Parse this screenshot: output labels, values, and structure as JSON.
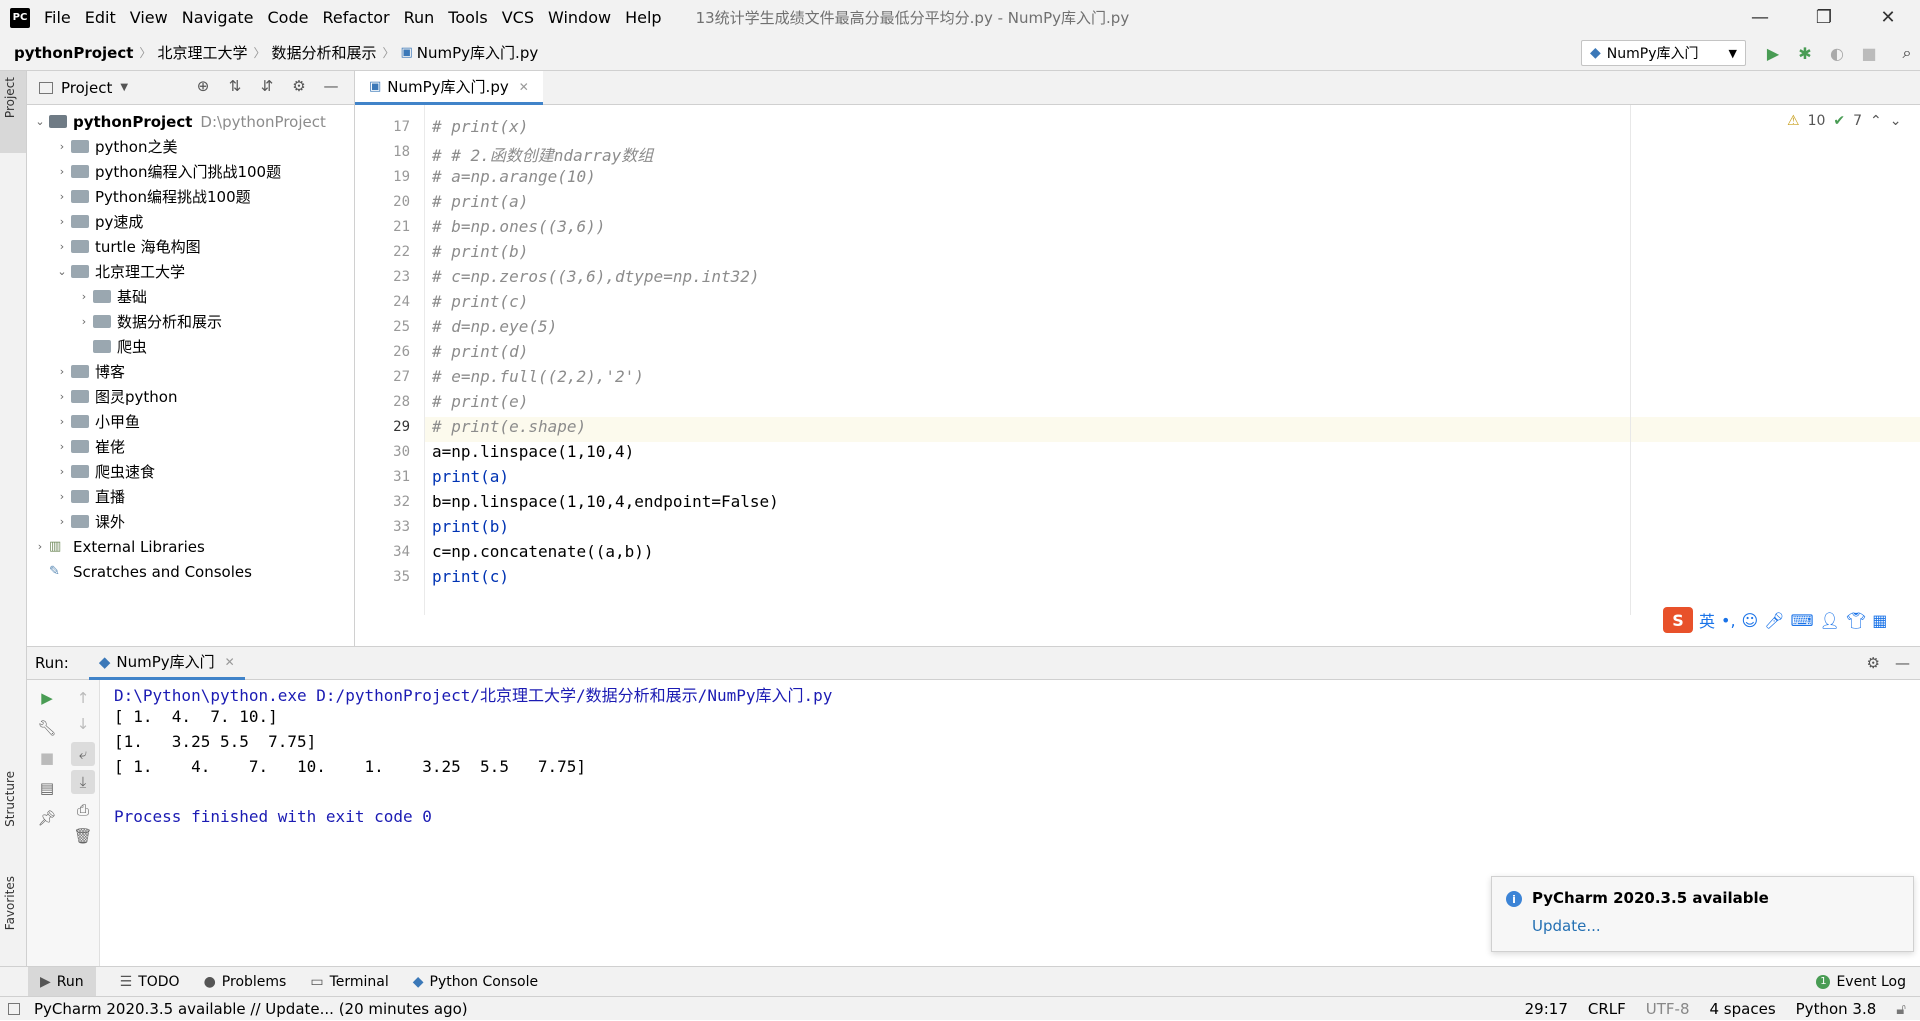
{
  "titlebar": {
    "menu": [
      "File",
      "Edit",
      "View",
      "Navigate",
      "Code",
      "Refactor",
      "Run",
      "Tools",
      "VCS",
      "Window",
      "Help"
    ],
    "window_title": "13统计学生成绩文件最高分最低分平均分.py - NumPy库入门.py"
  },
  "breadcrumb": [
    "pythonProject",
    "北京理工大学",
    "数据分析和展示",
    "NumPy库入门.py"
  ],
  "run_config": "NumPy库入门",
  "left_strip": {
    "project": "Project",
    "structure": "Structure",
    "favorites": "Favorites"
  },
  "project": {
    "title": "Project",
    "root_name": "pythonProject",
    "root_path": "D:\\pythonProject",
    "items": [
      {
        "label": "python之美"
      },
      {
        "label": "python编程入门挑战100题"
      },
      {
        "label": "Python编程挑战100题"
      },
      {
        "label": "py速成"
      },
      {
        "label": "turtle 海龟构图"
      },
      {
        "label": "北京理工大学"
      },
      {
        "label": "基础"
      },
      {
        "label": "数据分析和展示"
      },
      {
        "label": "爬虫"
      },
      {
        "label": "博客"
      },
      {
        "label": "图灵python"
      },
      {
        "label": "小甲鱼"
      },
      {
        "label": "崔佬"
      },
      {
        "label": "爬虫速食"
      },
      {
        "label": "直播"
      },
      {
        "label": "课外"
      }
    ],
    "external": "External Libraries",
    "scratches": "Scratches and Consoles"
  },
  "editor": {
    "tab": "NumPy库入门.py",
    "lines": [
      {
        "n": "17",
        "text": "# print(x)"
      },
      {
        "n": "18",
        "text": "# # 2.函数创建ndarray数组"
      },
      {
        "n": "19",
        "text": "# a=np.arange(10)"
      },
      {
        "n": "20",
        "text": "# print(a)"
      },
      {
        "n": "21",
        "text": "# b=np.ones((3,6))"
      },
      {
        "n": "22",
        "text": "# print(b)"
      },
      {
        "n": "23",
        "text": "# c=np.zeros((3,6),dtype=np.int32)"
      },
      {
        "n": "24",
        "text": "# print(c)"
      },
      {
        "n": "25",
        "text": "# d=np.eye(5)"
      },
      {
        "n": "26",
        "text": "# print(d)"
      },
      {
        "n": "27",
        "text": "# e=np.full((2,2),'2')"
      },
      {
        "n": "28",
        "text": "# print(e)"
      },
      {
        "n": "29",
        "text": "# print(e.shape)"
      },
      {
        "n": "30",
        "text": "a=np.linspace(1,10,4)"
      },
      {
        "n": "31",
        "text": "print(a)"
      },
      {
        "n": "32",
        "text": "b=np.linspace(1,10,4,endpoint=False)"
      },
      {
        "n": "33",
        "text": "print(b)"
      },
      {
        "n": "34",
        "text": "c=np.concatenate((a,b))"
      },
      {
        "n": "35",
        "text": "print(c)"
      }
    ],
    "warnings": "10",
    "typos": "7"
  },
  "ime": {
    "label": "英"
  },
  "run": {
    "label": "Run:",
    "tab": "NumPy库入门",
    "console": [
      "D:\\Python\\python.exe D:/pythonProject/北京理工大学/数据分析和展示/NumPy库入门.py",
      "[ 1.  4.  7. 10.]",
      "[1.   3.25 5.5  7.75]",
      "[ 1.    4.    7.   10.    1.    3.25  5.5   7.75]",
      "",
      "Process finished with exit code 0"
    ]
  },
  "notification": {
    "title": "PyCharm 2020.3.5 available",
    "link": "Update..."
  },
  "bottom_tools": [
    "Run",
    "TODO",
    "Problems",
    "Terminal",
    "Python Console"
  ],
  "event_log": "Event Log",
  "status": {
    "message": "PyCharm 2020.3.5 available // Update... (20 minutes ago)",
    "position": "29:17",
    "line_sep": "CRLF",
    "encoding": "UTF-8",
    "indent": "4 spaces",
    "interpreter": "Python 3.8"
  },
  "colors": {
    "accent": "#4083c9",
    "run_green": "#499c54",
    "link": "#2470b3"
  }
}
